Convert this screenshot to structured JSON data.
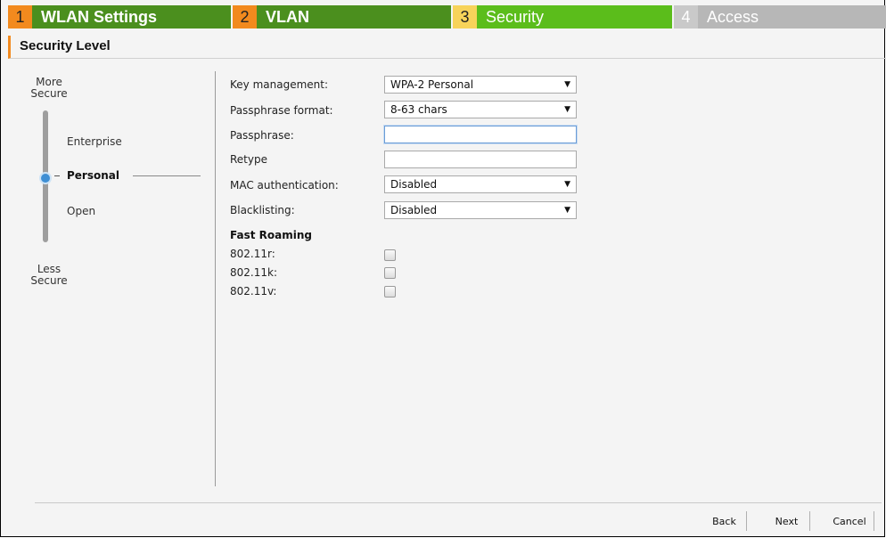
{
  "wizard": {
    "tabs": [
      {
        "num": "1",
        "label": "WLAN Settings"
      },
      {
        "num": "2",
        "label": "VLAN"
      },
      {
        "num": "3",
        "label": "Security"
      },
      {
        "num": "4",
        "label": "Access"
      }
    ],
    "active_tab": "Security"
  },
  "section": {
    "title": "Security Level"
  },
  "security_level": {
    "top_label_1": "More",
    "top_label_2": "Secure",
    "bottom_label_1": "Less",
    "bottom_label_2": "Secure",
    "options": [
      "Enterprise",
      "Personal",
      "Open"
    ],
    "selected": "Personal"
  },
  "form": {
    "key_management": {
      "label": "Key management:",
      "value": "WPA-2 Personal"
    },
    "passphrase_format": {
      "label": "Passphrase format:",
      "value": "8-63 chars"
    },
    "passphrase": {
      "label": "Passphrase:",
      "value": ""
    },
    "retype": {
      "label": "Retype",
      "value": ""
    },
    "mac_auth": {
      "label": "MAC authentication:",
      "value": "Disabled"
    },
    "blacklisting": {
      "label": "Blacklisting:",
      "value": "Disabled"
    }
  },
  "fast_roaming": {
    "title": "Fast Roaming",
    "items": [
      {
        "label": "802.11r:",
        "checked": false
      },
      {
        "label": "802.11k:",
        "checked": false
      },
      {
        "label": "802.11v:",
        "checked": false
      }
    ]
  },
  "footer": {
    "back": "Back",
    "next": "Next",
    "cancel": "Cancel"
  },
  "colors": {
    "tab_done": "#4b8f1e",
    "tab_active": "#5bbd1b",
    "tab_inactive": "#b7b7b7",
    "step_num_done": "#f28a1e",
    "step_num_active": "#f7d35a",
    "accent": "#f28a1e"
  }
}
